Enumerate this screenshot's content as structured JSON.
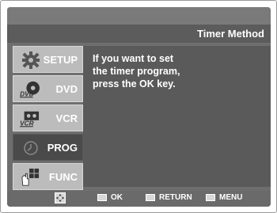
{
  "header": {
    "title": "Timer Method"
  },
  "sidebar": {
    "items": [
      {
        "label": "SETUP",
        "icon": "gear-icon",
        "selected": false
      },
      {
        "label": "DVD",
        "icon": "dvd-icon",
        "selected": false
      },
      {
        "label": "VCR",
        "icon": "vcr-icon",
        "selected": false
      },
      {
        "label": "PROG",
        "icon": "clock-icon",
        "selected": true
      },
      {
        "label": "FUNC",
        "icon": "func-hand-icon",
        "selected": false
      }
    ],
    "dvd_icon_text": "DVD",
    "vcr_icon_text": "VCR"
  },
  "main": {
    "help_lines": [
      "If you want to set",
      "the timer program,",
      "press the  OK  key."
    ]
  },
  "footer": {
    "ok_label": "OK",
    "return_label": "RETURN",
    "menu_label": "MENU"
  },
  "colors": {
    "screen_bg": "#6e6e6e",
    "item_bg": "#bcbcbc",
    "item_selected_bg": "#4a4a4a",
    "text": "#ffffff"
  }
}
